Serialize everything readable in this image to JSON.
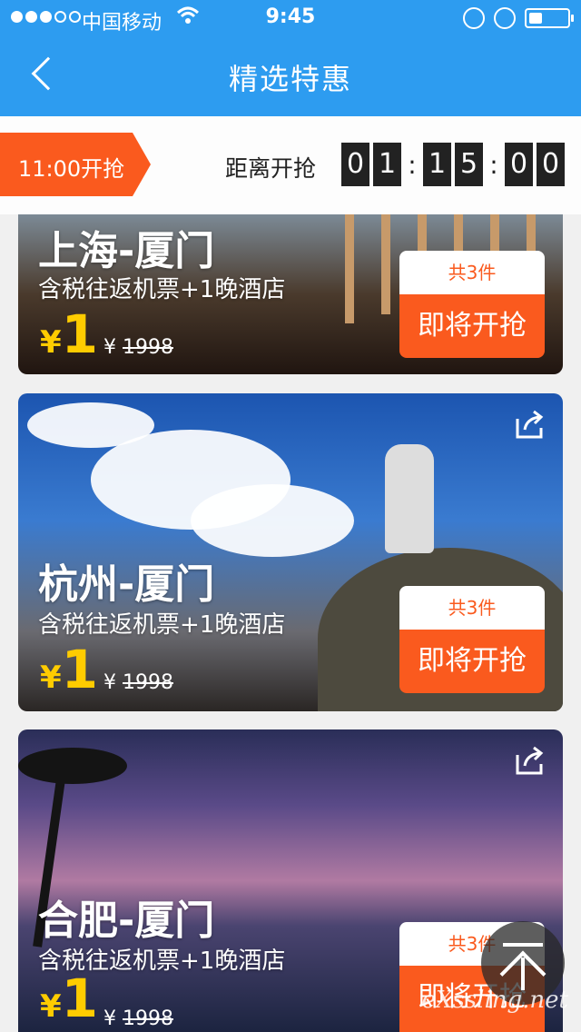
{
  "status_bar": {
    "carrier": "中国移动",
    "time": "9:45",
    "signal_bars": 3,
    "battery_level": 0.35
  },
  "nav": {
    "title": "精选特惠"
  },
  "sale": {
    "time_tag": "11:00开抢",
    "countdown_label": "距离开抢",
    "countdown_digits": [
      "0",
      "1",
      "1",
      "5",
      "0",
      "0"
    ]
  },
  "deals": [
    {
      "route": "上海-厦门",
      "desc": "含税往返机票+1晚酒店",
      "currency": "¥",
      "price": "1",
      "orig_prefix": "¥",
      "orig_price": "1998",
      "qty": "共3件",
      "button": "即将开抢"
    },
    {
      "route": "杭州-厦门",
      "desc": "含税往返机票+1晚酒店",
      "currency": "¥",
      "price": "1",
      "orig_prefix": "¥",
      "orig_price": "1998",
      "qty": "共3件",
      "button": "即将开抢"
    },
    {
      "route": "合肥-厦门",
      "desc": "含税往返机票+1晚酒店",
      "currency": "¥",
      "price": "1",
      "orig_prefix": "¥",
      "orig_price": "1998",
      "qty": "共3件",
      "button": "即将开抢"
    }
  ],
  "icons": {
    "back": "chevron-left-icon",
    "share": "share-icon",
    "top": "back-to-top-icon"
  },
  "colors": {
    "header": "#2d9cf0",
    "accent": "#fa5a1e",
    "price": "#ffcc00"
  },
  "watermark": "eXssling.net"
}
